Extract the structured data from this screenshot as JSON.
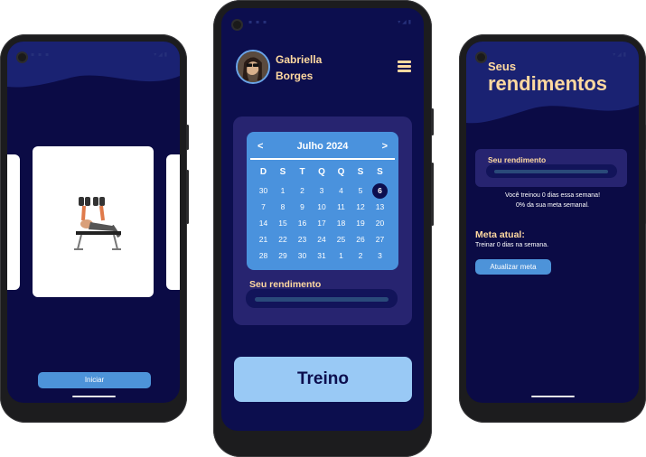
{
  "phone_left": {
    "start_button": "Iniciar"
  },
  "phone_center": {
    "user": {
      "first_name": "Gabriella",
      "last_name": "Borges"
    },
    "calendar": {
      "prev": "<",
      "next": ">",
      "month_label": "Julho 2024",
      "weekdays": [
        "D",
        "S",
        "T",
        "Q",
        "Q",
        "S",
        "S"
      ],
      "days": [
        [
          "30",
          "1",
          "2",
          "3",
          "4",
          "5",
          "6"
        ],
        [
          "7",
          "8",
          "9",
          "10",
          "11",
          "12",
          "13"
        ],
        [
          "14",
          "15",
          "16",
          "17",
          "18",
          "19",
          "20"
        ],
        [
          "21",
          "22",
          "23",
          "24",
          "25",
          "26",
          "27"
        ],
        [
          "28",
          "29",
          "30",
          "31",
          "1",
          "2",
          "3"
        ]
      ],
      "selected_day": "6"
    },
    "progress_label": "Seu rendimento",
    "train_button": "Treino"
  },
  "phone_right": {
    "title_line1": "Seus",
    "title_line2": "rendimentos",
    "progress_label": "Seu rendimento",
    "summary_line1": "Você treinou 0 dias essa semana!",
    "summary_line2": "0% da sua meta semanal.",
    "goal_title": "Meta atual:",
    "goal_text": "Treinar 0 dias na semana.",
    "update_button": "Atualizar meta"
  },
  "colors": {
    "background": "#0b0b45",
    "accent_blue": "#4a92dd",
    "light_blue": "#99c9f5",
    "title_gold": "#ffd9a0",
    "panel": "#272470"
  }
}
